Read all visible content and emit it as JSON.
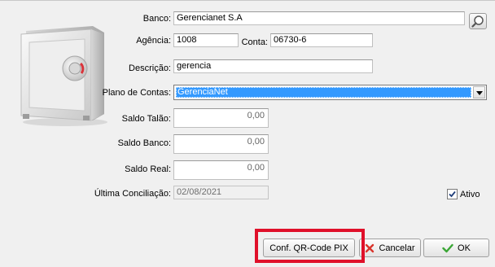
{
  "form": {
    "banco": {
      "label": "Banco:",
      "value": "Gerencianet S.A"
    },
    "agencia": {
      "label": "Agência:",
      "value": "1008"
    },
    "conta": {
      "label": "Conta:",
      "value": "06730-6"
    },
    "descricao": {
      "label": "Descrição:",
      "value": "gerencia"
    },
    "plano": {
      "label": "Plano de Contas:",
      "value": "GerenciaNet"
    },
    "saldo_talao": {
      "label": "Saldo Talão:",
      "value": "0,00"
    },
    "saldo_banco": {
      "label": "Saldo Banco:",
      "value": "0,00"
    },
    "saldo_real": {
      "label": "Saldo Real:",
      "value": "0,00"
    },
    "ultima_conciliacao": {
      "label": "Última Conciliação:",
      "value": "02/08/2021"
    },
    "ativo": {
      "label": "Ativo",
      "checked": true
    }
  },
  "buttons": {
    "pix": "Conf. QR-Code PIX",
    "cancel": "Cancelar",
    "ok": "OK"
  },
  "icons": {
    "safe": "safe-icon",
    "search": "search-icon",
    "cancel": "cancel-x-icon",
    "ok": "checkmark-icon"
  },
  "colors": {
    "selection": "#3399ff",
    "highlight_box": "#e0102a",
    "ok_check": "#3aa635",
    "cancel_x": "#d9342b"
  }
}
